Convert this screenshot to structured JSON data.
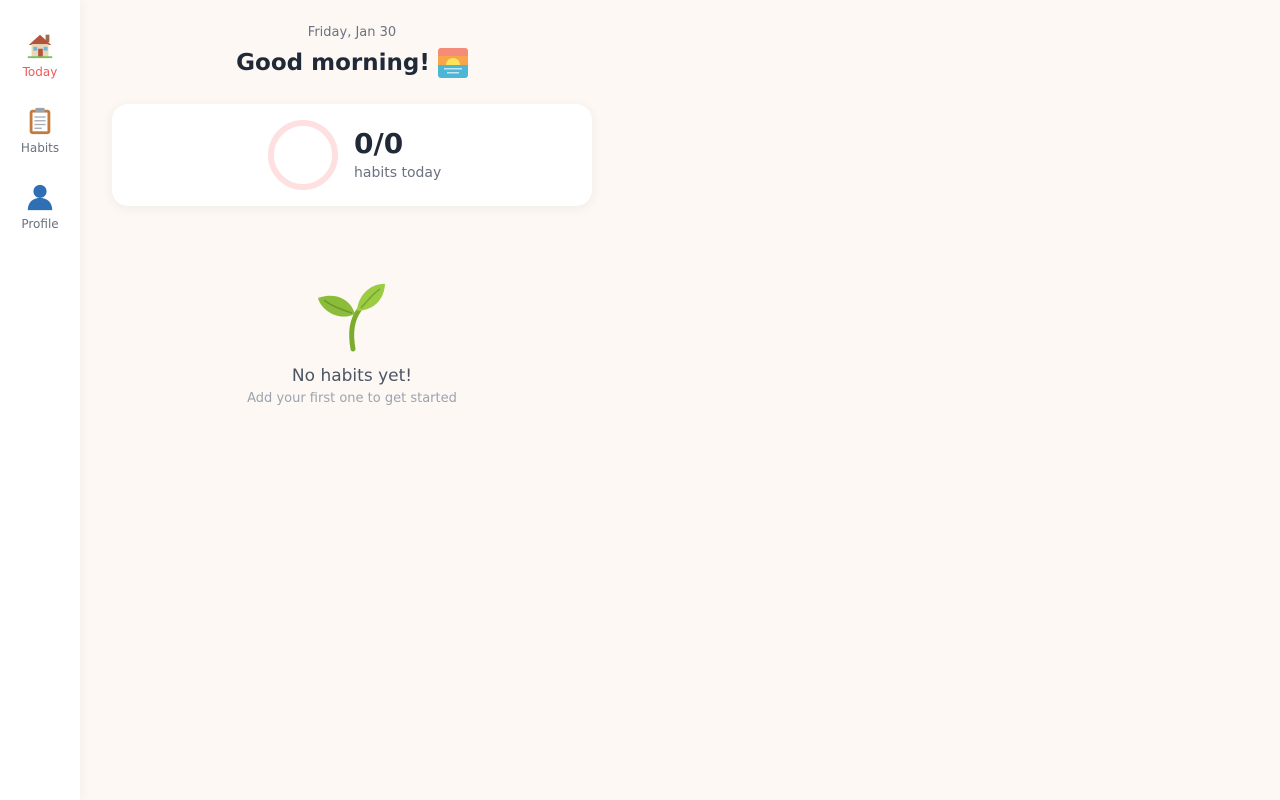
{
  "sidebar": {
    "items": [
      {
        "label": "Today",
        "icon": "house-icon",
        "active": true
      },
      {
        "label": "Habits",
        "icon": "clipboard-icon",
        "active": false
      },
      {
        "label": "Profile",
        "icon": "user-icon",
        "active": false
      }
    ]
  },
  "header": {
    "date": "Friday, Jan 30",
    "greeting": "Good morning!",
    "greeting_icon": "sunrise-icon"
  },
  "progress": {
    "completed": 0,
    "total": 0,
    "count_text": "0/0",
    "label": "habits today",
    "ring_color": "#fde0df"
  },
  "empty_state": {
    "icon": "sprout-icon",
    "title": "No habits yet!",
    "subtitle": "Add your first one to get started"
  },
  "colors": {
    "accent": "#ef5b5b",
    "background": "#fdf8f4",
    "text_primary": "#1f2937",
    "text_secondary": "#6b7280"
  }
}
